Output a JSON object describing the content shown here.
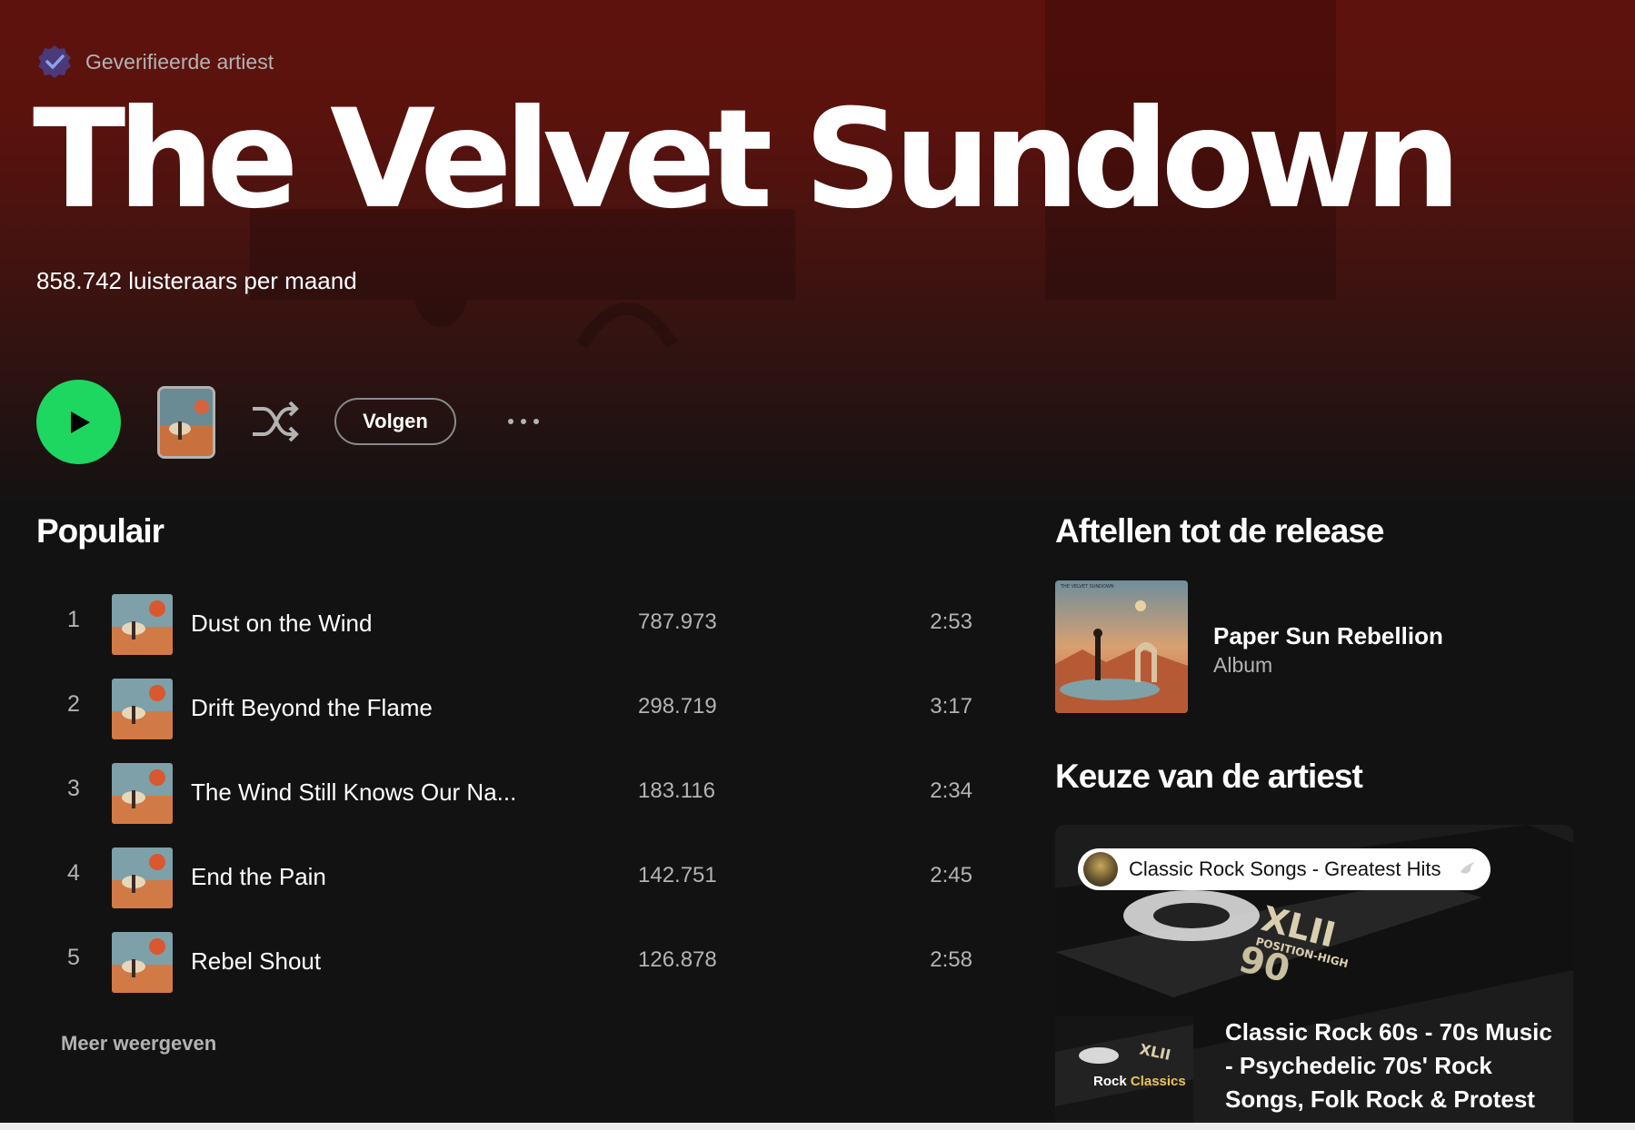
{
  "artist": {
    "verified_label": "Geverifieerde artiest",
    "name": "The Velvet Sundown",
    "monthly_listeners": "858.742 luisteraars per maand"
  },
  "controls": {
    "follow_label": "Volgen"
  },
  "popular": {
    "title": "Populair",
    "tracks": [
      {
        "rank": "1",
        "title": "Dust on the Wind",
        "plays": "787.973",
        "duration": "2:53"
      },
      {
        "rank": "2",
        "title": "Drift Beyond the Flame",
        "plays": "298.719",
        "duration": "3:17"
      },
      {
        "rank": "3",
        "title": "The Wind Still Knows Our Na...",
        "plays": "183.116",
        "duration": "2:34"
      },
      {
        "rank": "4",
        "title": "End the Pain",
        "plays": "142.751",
        "duration": "2:45"
      },
      {
        "rank": "5",
        "title": "Rebel Shout",
        "plays": "126.878",
        "duration": "2:58"
      }
    ],
    "show_more_label": "Meer weergeven"
  },
  "countdown": {
    "title": "Aftellen tot de release",
    "release_title": "Paper Sun Rebellion",
    "release_type": "Album",
    "cover_caption": "THE VELVET SUNDOWN"
  },
  "artist_pick": {
    "title": "Keuze van de artiest",
    "pill_label": "Classic Rock Songs - Greatest Hits",
    "thumb_label_a": "Rock ",
    "thumb_label_b": "Classics",
    "description": "Classic Rock 60s - 70s Music - Psychedelic 70s' Rock Songs, Folk Rock & Protest",
    "cassette_text": "XLII",
    "cassette_sub": "POSITION-HIGH",
    "cassette_num": "90"
  },
  "colors": {
    "accent_green": "#1ed760",
    "hero_red": "#5e120d",
    "background": "#121212",
    "secondary_text": "#b3b3b3"
  }
}
